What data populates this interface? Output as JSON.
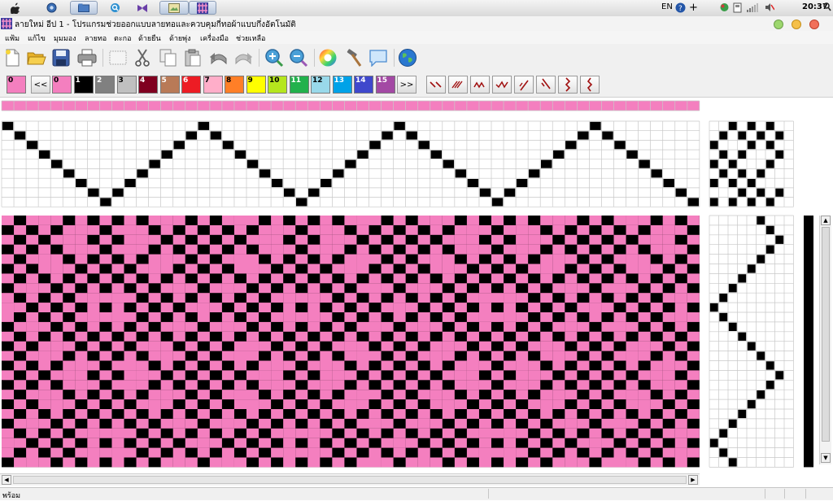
{
  "taskbar": {
    "tray": {
      "language": "EN",
      "clock": "20:37"
    }
  },
  "window": {
    "title": "ลายใหม่ อีป 1 - โปรแกรมช่วยออกแบบลายทอและควบคุมกี่ทอผ้าแบบกึ่งอัตโนมัติ"
  },
  "menu": {
    "items": [
      "แฟ้ม",
      "แก้ไข",
      "มุมมอง",
      "ลายทอ",
      "ตะกอ",
      "ด้ายยืน",
      "ด้ายพุ่ง",
      "เครื่องมือ",
      "ช่วยเหลือ"
    ]
  },
  "toolbar": {
    "icons": [
      "new-file",
      "open-folder",
      "save-disk",
      "print",
      "select-rect",
      "cut-scissors",
      "copy",
      "paste",
      "undo",
      "redo",
      "zoom-in",
      "zoom-out",
      "color-wheel",
      "hammer",
      "speech-bubble",
      "globe"
    ]
  },
  "palette": {
    "current": {
      "label": "0",
      "color": "#f47fbf"
    },
    "prev_label": "<<",
    "next_label": ">>",
    "colors": [
      {
        "label": "0",
        "color": "#f47fbf"
      },
      {
        "label": "1",
        "color": "#000000"
      },
      {
        "label": "2",
        "color": "#808080"
      },
      {
        "label": "3",
        "color": "#c0c0c0"
      },
      {
        "label": "4",
        "color": "#800020"
      },
      {
        "label": "5",
        "color": "#b97a57"
      },
      {
        "label": "6",
        "color": "#ed1c24"
      },
      {
        "label": "7",
        "color": "#ffaec9"
      },
      {
        "label": "8",
        "color": "#ff7f27"
      },
      {
        "label": "9",
        "color": "#ffff00"
      },
      {
        "label": "10",
        "color": "#b5e61d"
      },
      {
        "label": "11",
        "color": "#22b14c"
      },
      {
        "label": "12",
        "color": "#99d9ea"
      },
      {
        "label": "13",
        "color": "#00a2e8"
      },
      {
        "label": "14",
        "color": "#3f48cc"
      },
      {
        "label": "15",
        "color": "#a349a4"
      }
    ],
    "pattern_buttons": [
      "twill-ne",
      "twill-ne-double",
      "zigzag-small",
      "zigzag-large",
      "twill-steep",
      "twill-steep-alt",
      "zigzag-vertical",
      "zigzag-vertical-alt"
    ]
  },
  "draft": {
    "colors": {
      "weft": "#f47fbf",
      "warp": "#000000",
      "grid_line": "#c8c8c8"
    },
    "warp_threads": 57,
    "shafts": 8,
    "weft_picks": 26,
    "threading": [
      8,
      7,
      6,
      5,
      4,
      3,
      2,
      1,
      0,
      1,
      2,
      3,
      4,
      5,
      6,
      7,
      8,
      7,
      6,
      5,
      4,
      3,
      2,
      1,
      0,
      1,
      2,
      3,
      4,
      5,
      6,
      7,
      8,
      7,
      6,
      5,
      4,
      3,
      2,
      1,
      0,
      1,
      2,
      3,
      4,
      5,
      6,
      7,
      8,
      7,
      6,
      5,
      4,
      3,
      2,
      1,
      0
    ],
    "tieup": [
      [
        0,
        0,
        1,
        0,
        1,
        0,
        1,
        0
      ],
      [
        0,
        1,
        0,
        1,
        0,
        1,
        0,
        1
      ],
      [
        1,
        0,
        0,
        0,
        1,
        0,
        1,
        0
      ],
      [
        0,
        1,
        0,
        1,
        0,
        0,
        0,
        1
      ],
      [
        1,
        0,
        1,
        0,
        0,
        0,
        1,
        0
      ],
      [
        0,
        1,
        0,
        1,
        0,
        1,
        0,
        0
      ],
      [
        1,
        0,
        1,
        0,
        1,
        0,
        0,
        0
      ],
      [
        0,
        0,
        0,
        1,
        0,
        1,
        0,
        1
      ],
      [
        1,
        0,
        1,
        0,
        1,
        0,
        1,
        0
      ]
    ],
    "treadling": [
      5,
      6,
      7,
      6,
      5,
      4,
      3,
      2,
      1,
      0,
      1,
      2,
      3,
      4,
      5,
      6,
      7,
      6,
      5,
      4,
      3,
      2,
      1,
      0,
      1,
      2
    ]
  },
  "status": {
    "text": "พร้อม"
  }
}
